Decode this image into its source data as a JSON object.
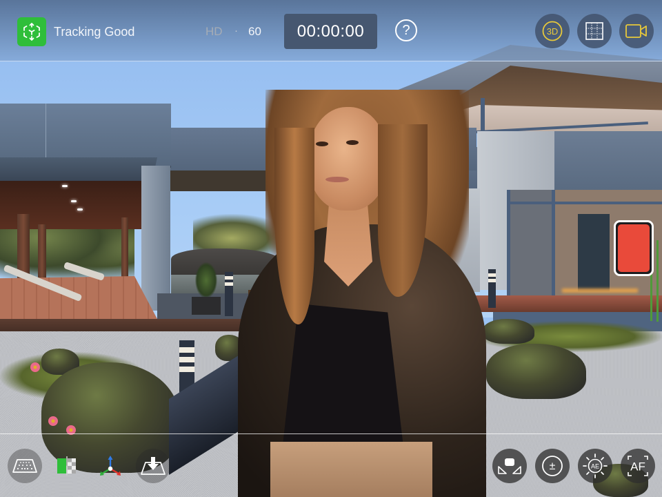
{
  "topbar": {
    "tracking": {
      "icon": "ar-cube-icon",
      "label": "Tracking Good",
      "color": "#2fbe3a"
    },
    "resolution": "HD",
    "separator": "·",
    "fps": "60",
    "timecode": "00:00:00",
    "help": {
      "icon": "help-icon",
      "label": "?"
    },
    "right_buttons": [
      {
        "name": "3d-mode-button",
        "icon": "3d-icon",
        "label": "3D",
        "color": "#e8c93a"
      },
      {
        "name": "grid-button",
        "icon": "grid-icon"
      },
      {
        "name": "camera-button",
        "icon": "video-camera-icon",
        "color": "#e8c93a"
      }
    ]
  },
  "record_button": {
    "icon": "record-icon",
    "color": "#e94a3a"
  },
  "bottombar": {
    "left_buttons": [
      {
        "name": "floor-grid-button",
        "icon": "floor-grid-icon"
      },
      {
        "name": "green-screen-button",
        "icon": "keyer-split-icon",
        "color": "#2fbe3a"
      },
      {
        "name": "axis-gizmo-button",
        "icon": "xyz-axis-icon"
      },
      {
        "name": "place-floor-button",
        "icon": "place-floor-icon"
      }
    ],
    "right_buttons": [
      {
        "name": "subject-placement-button",
        "icon": "subject-placement-icon"
      },
      {
        "name": "exposure-compensation-button",
        "icon": "exposure-icon",
        "label": "±"
      },
      {
        "name": "auto-exposure-button",
        "icon": "auto-exposure-icon",
        "label": "AE"
      },
      {
        "name": "auto-focus-button",
        "icon": "auto-focus-icon",
        "label": "AF"
      }
    ]
  }
}
